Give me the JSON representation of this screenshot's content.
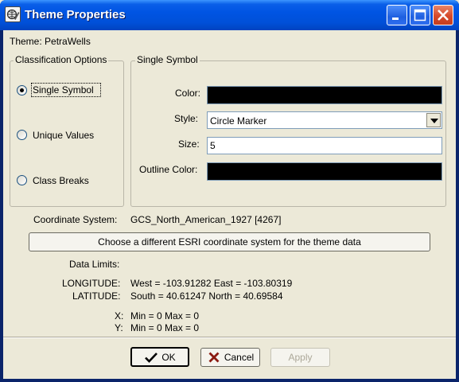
{
  "window": {
    "title": "Theme Properties"
  },
  "theme": {
    "label": "Theme: PetraWells"
  },
  "classification": {
    "legend": "Classification Options",
    "options": [
      {
        "label": "Single Symbol",
        "selected": true
      },
      {
        "label": "Unique Values",
        "selected": false
      },
      {
        "label": "Class Breaks",
        "selected": false
      }
    ]
  },
  "single_symbol": {
    "legend": "Single Symbol",
    "color_label": "Color:",
    "color_value": "#000000",
    "style_label": "Style:",
    "style_value": "Circle Marker",
    "size_label": "Size:",
    "size_value": "5",
    "outline_label": "Outline Color:",
    "outline_value": "#000000"
  },
  "coordinate": {
    "label": "Coordinate System:",
    "value": "GCS_North_American_1927 [4267]",
    "change_button": "Choose a different ESRI coordinate system for the theme data"
  },
  "limits": {
    "label": "Data Limits:",
    "longitude_label": "LONGITUDE:",
    "longitude_value": "West = -103.91282 East = -103.80319",
    "latitude_label": "LATITUDE:",
    "latitude_value": "South = 40.61247 North = 40.69584",
    "x_label": "X:",
    "x_value": "Min = 0 Max = 0",
    "y_label": "Y:",
    "y_value": "Min = 0 Max = 0"
  },
  "buttons": {
    "ok": "OK",
    "cancel": "Cancel",
    "apply": "Apply"
  },
  "icons": {
    "window": "globe-pencil-icon",
    "ok": "checkmark-icon",
    "cancel": "x-mark-icon"
  }
}
